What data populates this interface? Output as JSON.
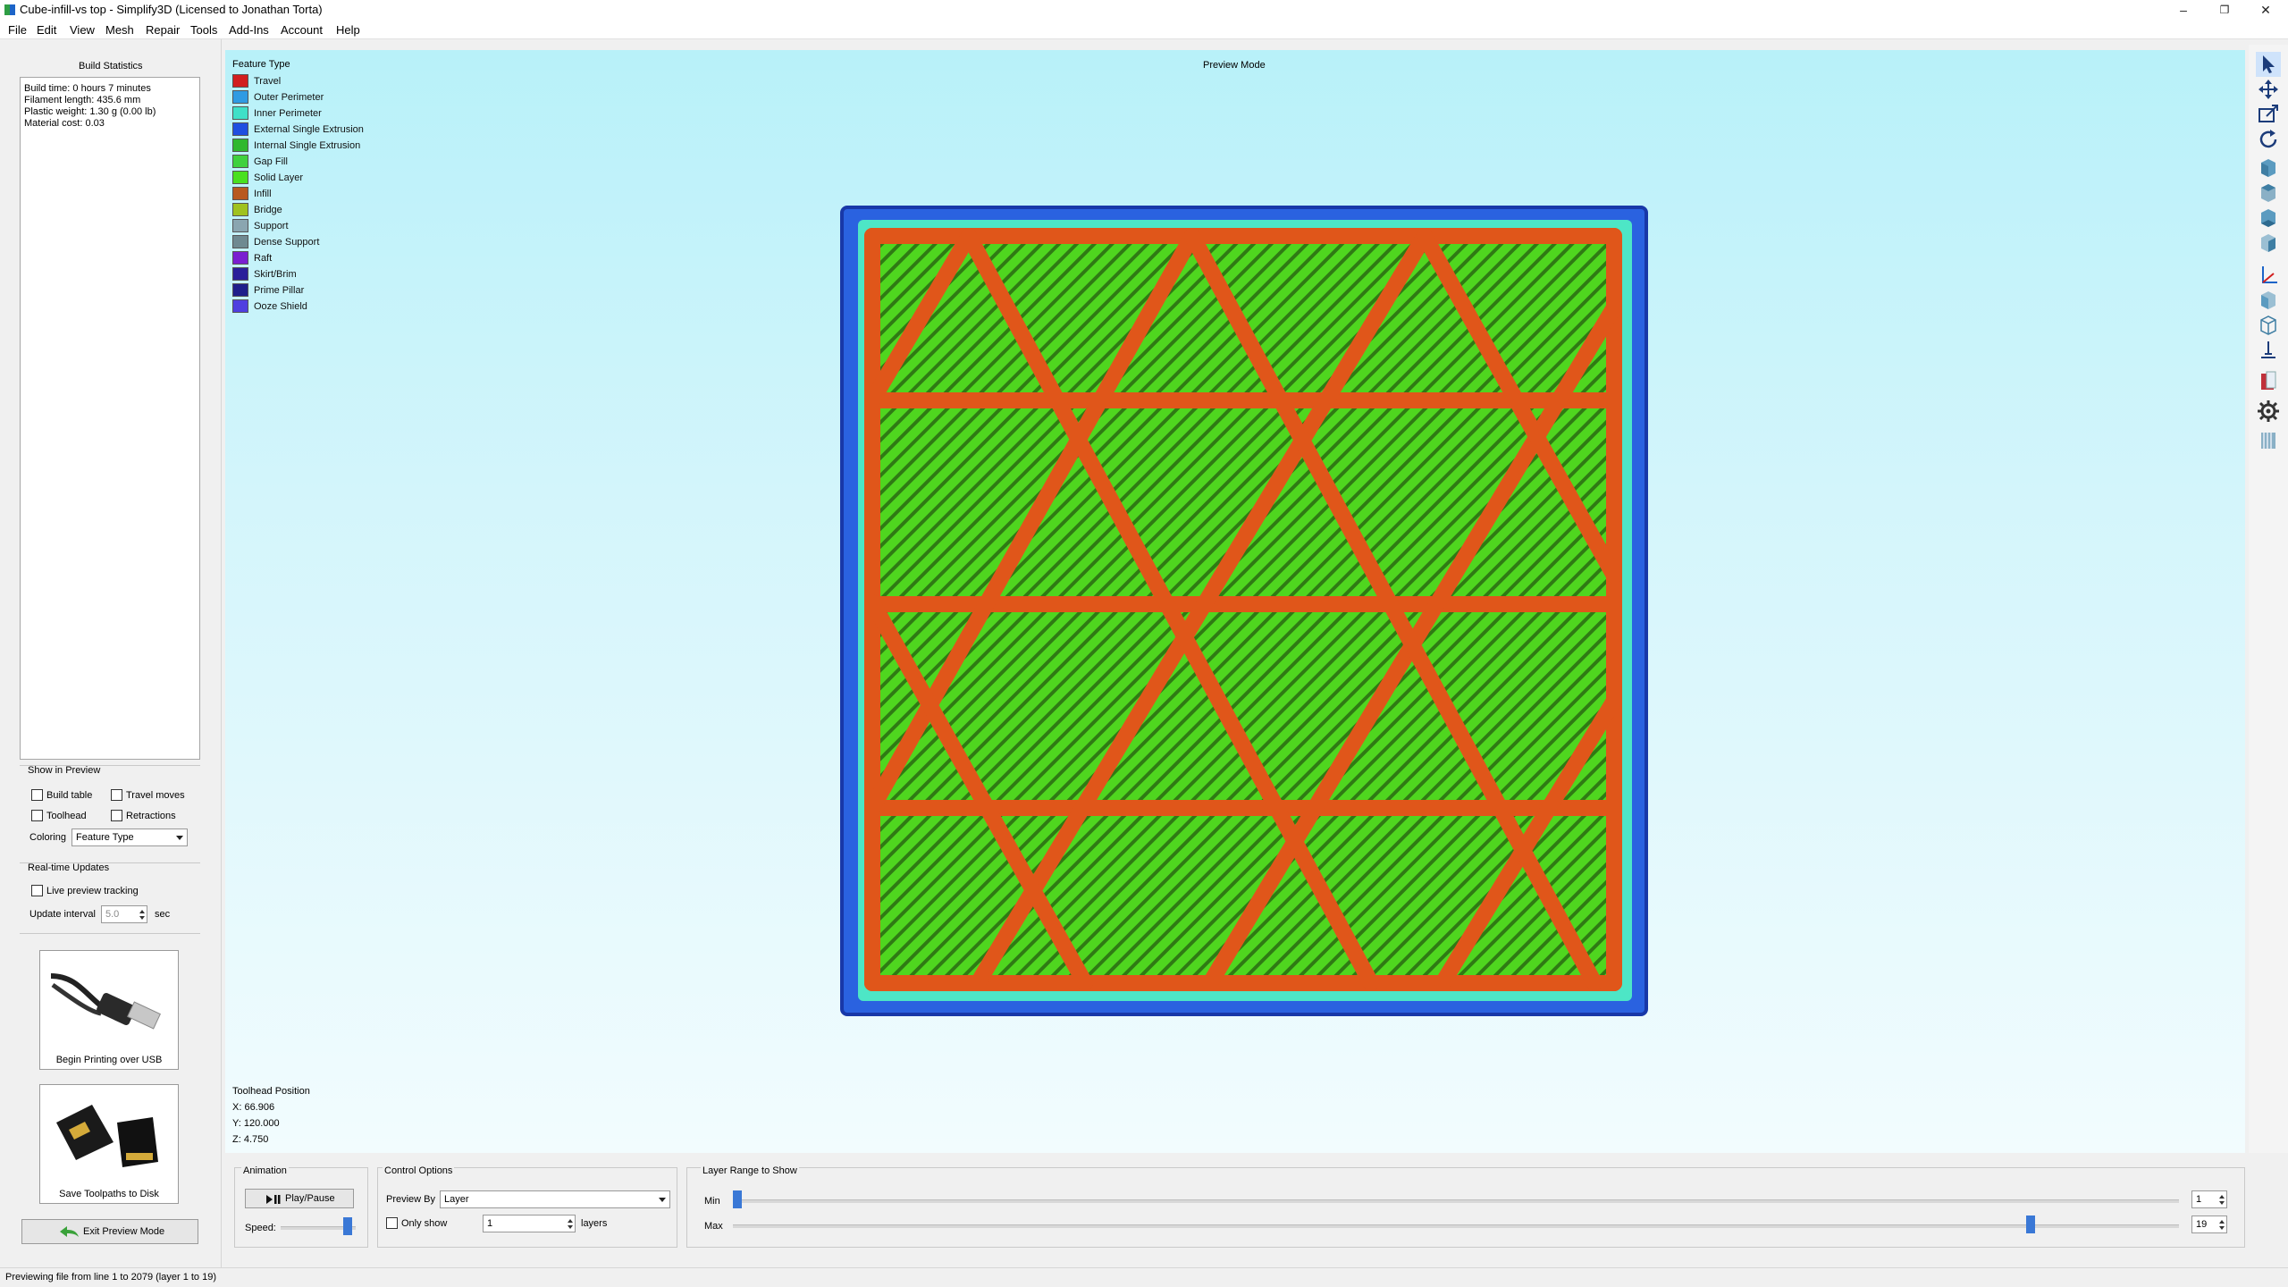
{
  "window": {
    "title": "Cube-infill-vs top - Simplify3D (Licensed to Jonathan Torta)",
    "minimize": "–",
    "restore": "❐",
    "close": "✕"
  },
  "menu": [
    "File",
    "Edit",
    "View",
    "Mesh",
    "Repair",
    "Tools",
    "Add-Ins",
    "Account",
    "Help"
  ],
  "left_panel": {
    "build_stats_title": "Build Statistics",
    "stats": [
      "Build time: 0 hours 7 minutes",
      "Filament length: 435.6 mm",
      "Plastic weight: 1.30 g (0.00 lb)",
      "Material cost: 0.03"
    ],
    "show_in_preview": {
      "title": "Show in Preview",
      "build_table": "Build table",
      "travel_moves": "Travel moves",
      "toolhead": "Toolhead",
      "retractions": "Retractions",
      "coloring_label": "Coloring",
      "coloring_value": "Feature Type"
    },
    "realtime": {
      "title": "Real-time Updates",
      "live_tracking": "Live preview tracking",
      "interval_label": "Update interval",
      "interval_value": "5.0",
      "interval_unit": "sec"
    },
    "usb_button": "Begin Printing over USB",
    "sd_button": "Save Toolpaths to Disk",
    "exit_button": "Exit Preview Mode"
  },
  "viewport": {
    "legend_title": "Feature Type",
    "mode_label": "Preview Mode",
    "legend": [
      {
        "label": "Travel",
        "color": "#d11f1f"
      },
      {
        "label": "Outer Perimeter",
        "color": "#2f9be3"
      },
      {
        "label": "Inner Perimeter",
        "color": "#3fe0c8"
      },
      {
        "label": "External Single Extrusion",
        "color": "#1f4fe0"
      },
      {
        "label": "Internal Single Extrusion",
        "color": "#2fb82f"
      },
      {
        "label": "Gap Fill",
        "color": "#3fd13f"
      },
      {
        "label": "Solid Layer",
        "color": "#49e01f"
      },
      {
        "label": "Infill",
        "color": "#b85a1f"
      },
      {
        "label": "Bridge",
        "color": "#9fc21f"
      },
      {
        "label": "Support",
        "color": "#8aa6b0"
      },
      {
        "label": "Dense Support",
        "color": "#6f8a91"
      },
      {
        "label": "Raft",
        "color": "#7a1fd1"
      },
      {
        "label": "Skirt/Brim",
        "color": "#2a1f9a"
      },
      {
        "label": "Prime Pillar",
        "color": "#1f1f8a"
      },
      {
        "label": "Ooze Shield",
        "color": "#4f3fe0"
      }
    ],
    "toolhead": {
      "title": "Toolhead Position",
      "x": "X: 66.906",
      "y": "Y: 120.000",
      "z": "Z: 4.750"
    }
  },
  "bottom": {
    "animation_title": "Animation",
    "play_pause": "Play/Pause",
    "speed_label": "Speed:",
    "speed_level": 0.95,
    "control_title": "Control Options",
    "preview_by_label": "Preview By",
    "preview_by_value": "Layer",
    "only_show": "Only show",
    "only_show_value": "1",
    "layers_label": "layers",
    "layer_range_title": "Layer Range to Show",
    "min_label": "Min",
    "max_label": "Max",
    "min_value": "1",
    "max_value": "19",
    "min_level": 0.0,
    "max_level": 0.9
  },
  "status": "Previewing file from line 1 to 2079 (layer 1 to 19)",
  "icons": [
    "app-icon",
    "select-icon",
    "move-icon",
    "scale-icon",
    "rotate-icon",
    "view-default-icon",
    "view-top-icon",
    "view-bottom-icon",
    "view-front-icon",
    "view-axes-icon",
    "view-side-icon",
    "view-perspective-icon",
    "machine-icon",
    "cut-icon",
    "settings-gear-icon",
    "layers-icon",
    "usb-cable-icon",
    "sd-card-icon",
    "back-arrow-icon"
  ]
}
